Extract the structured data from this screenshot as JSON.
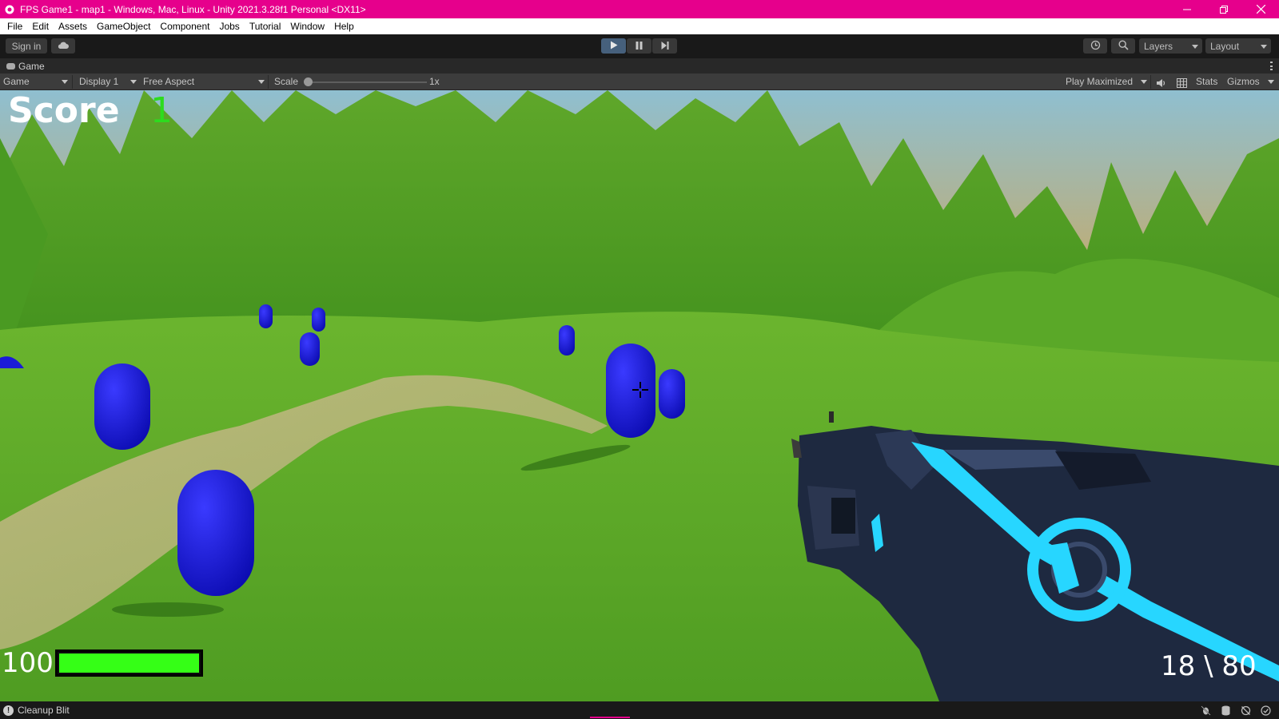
{
  "window": {
    "title": "FPS Game1 - map1 - Windows, Mac, Linux - Unity 2021.3.28f1 Personal <DX11>",
    "minimize_icon": "minimize-icon",
    "restore_icon": "restore-icon",
    "close_icon": "close-icon"
  },
  "menu": {
    "items": [
      "File",
      "Edit",
      "Assets",
      "GameObject",
      "Component",
      "Jobs",
      "Tutorial",
      "Window",
      "Help"
    ]
  },
  "toolbar": {
    "sign_in": "Sign in",
    "cloud_icon": "cloud-icon",
    "play_icon": "play-icon",
    "pause_icon": "pause-icon",
    "step_icon": "step-icon",
    "history_icon": "history-icon",
    "search_icon": "search-icon",
    "layers": "Layers",
    "layout": "Layout",
    "play_active": true
  },
  "game_tab": {
    "label": "Game"
  },
  "game_view_bar": {
    "view_mode": "Game",
    "display": "Display 1",
    "aspect": "Free Aspect",
    "scale_label": "Scale",
    "scale_value": "1x",
    "play_mode": "Play Maximized",
    "mute_icon": "speaker-icon",
    "stats_icon": "stats-grid-icon",
    "stats": "Stats",
    "gizmos": "Gizmos"
  },
  "hud": {
    "score_label": "Score",
    "score_value": "1",
    "health_value": "100",
    "health_fraction": 1.0,
    "ammo": "18 \\ 80",
    "crosshair_icon": "crosshair-icon",
    "colors": {
      "score_value": "#2ddc1e",
      "health_fill": "#35ff16",
      "enemy": "#1a1ae0"
    }
  },
  "status": {
    "message": "Cleanup Blit"
  },
  "colors": {
    "title_bar": "#e6008c",
    "play_button_active": "#46607c"
  }
}
